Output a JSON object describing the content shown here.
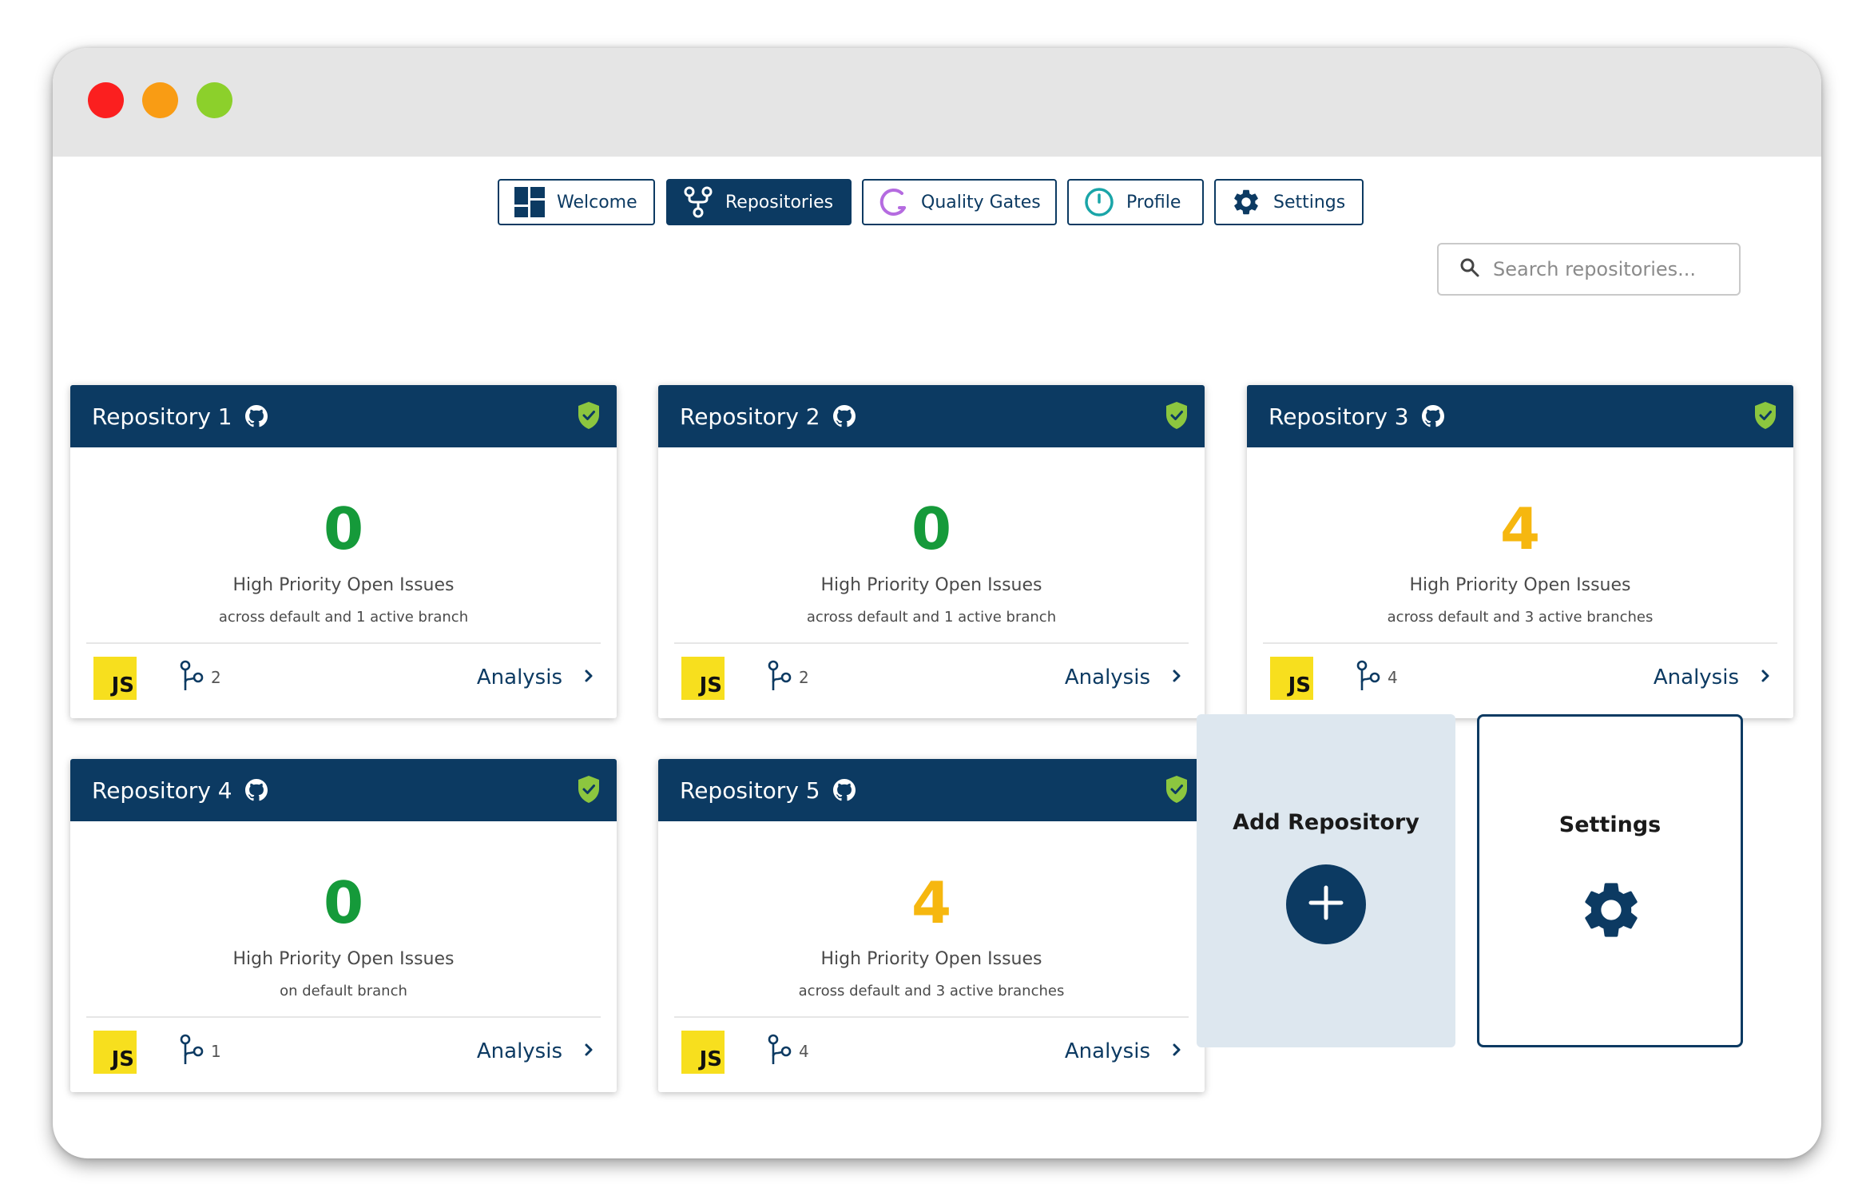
{
  "window": {
    "buttons": [
      "close",
      "minimize",
      "maximize"
    ]
  },
  "nav": {
    "tabs": [
      {
        "label": "Welcome",
        "icon": "dashboard-icon",
        "active": false
      },
      {
        "label": "Repositories",
        "icon": "repository-fork-icon",
        "active": true
      },
      {
        "label": "Quality Gates",
        "icon": "quality-gates-icon",
        "active": false
      },
      {
        "label": "Profile",
        "icon": "profile-icon",
        "active": false
      },
      {
        "label": "Settings",
        "icon": "gear-icon",
        "active": false
      }
    ]
  },
  "search": {
    "placeholder": "Search repositories..."
  },
  "repositories": [
    {
      "name": "Repository 1",
      "count": "0",
      "status": "good",
      "label": "High Priority Open Issues",
      "scope": "across default and 1 active branch",
      "language": "JS",
      "branches": "2",
      "action": "Analysis"
    },
    {
      "name": "Repository 2",
      "count": "0",
      "status": "good",
      "label": "High Priority Open Issues",
      "scope": "across default and 1 active branch",
      "language": "JS",
      "branches": "2",
      "action": "Analysis"
    },
    {
      "name": "Repository 3",
      "count": "4",
      "status": "warning",
      "label": "High Priority Open Issues",
      "scope": "across default and 3 active branches",
      "language": "JS",
      "branches": "4",
      "action": "Analysis"
    },
    {
      "name": "Repository 4",
      "count": "0",
      "status": "good",
      "label": "High Priority Open Issues",
      "scope": "on default branch",
      "language": "JS",
      "branches": "1",
      "action": "Analysis"
    },
    {
      "name": "Repository 5",
      "count": "4",
      "status": "warning",
      "label": "High Priority Open Issues",
      "scope": "across default and 3 active branches",
      "language": "JS",
      "branches": "4",
      "action": "Analysis"
    }
  ],
  "tiles": {
    "add_repository": "Add Repository",
    "settings": "Settings"
  },
  "colors": {
    "navy": "#0c3a62",
    "good": "#159a3a",
    "warning": "#f6b70f",
    "shield": "#8cc63f",
    "js": "#f7df1e"
  }
}
